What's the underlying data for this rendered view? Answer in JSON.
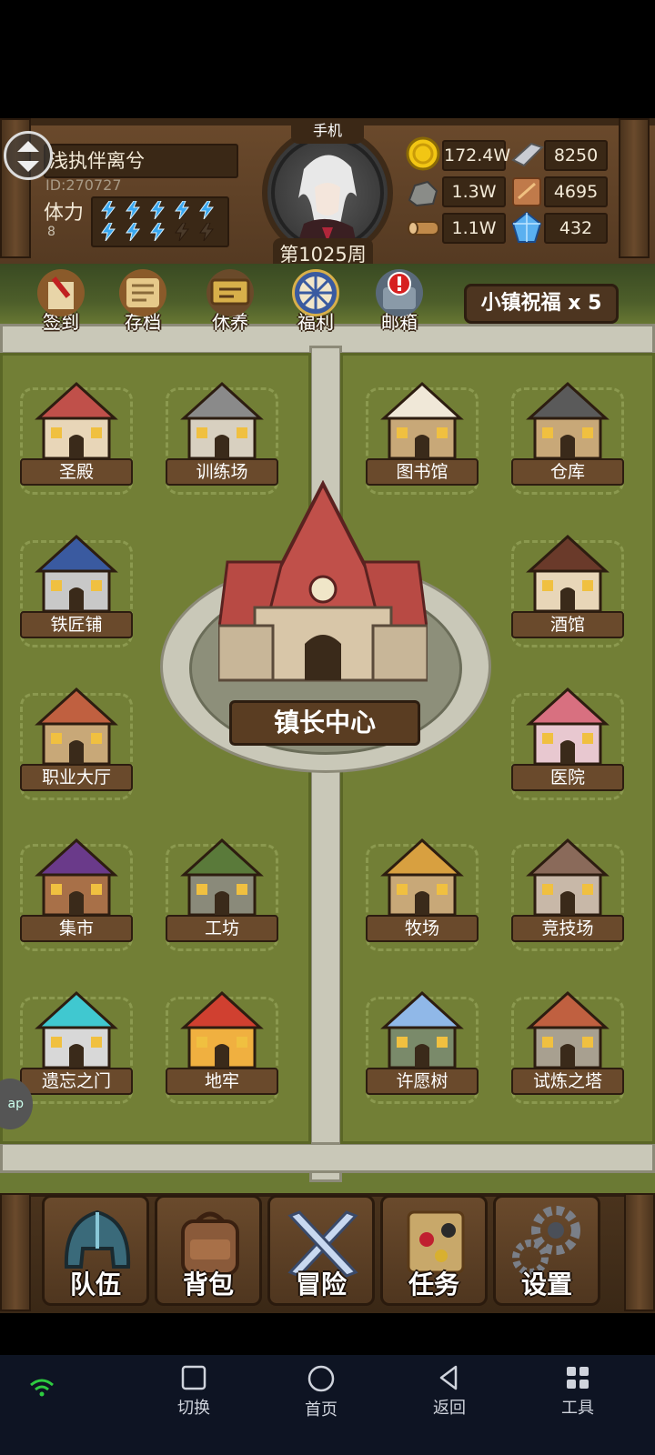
{
  "player": {
    "name": "浅执伴离兮",
    "id_text": "ID:270727",
    "stamina_label": "体力",
    "stamina_value": "8",
    "stamina_filled": 8,
    "stamina_total": 10
  },
  "avatar": {
    "device_tag": "手机",
    "week_label": "第1025周"
  },
  "resources": [
    {
      "icon": "gold-coin-icon",
      "value": "172.4W"
    },
    {
      "icon": "iron-ingot-icon",
      "value": "8250"
    },
    {
      "icon": "stone-icon",
      "value": "1.3W"
    },
    {
      "icon": "leather-icon",
      "value": "4695"
    },
    {
      "icon": "wood-log-icon",
      "value": "1.1W"
    },
    {
      "icon": "crystal-icon",
      "value": "432"
    }
  ],
  "quick_menu": [
    {
      "label": "签到",
      "icon": "sign-in-icon"
    },
    {
      "label": "存档",
      "icon": "save-scroll-icon"
    },
    {
      "label": "休养",
      "icon": "rest-sign-icon"
    },
    {
      "label": "福利",
      "icon": "welfare-wheel-icon"
    },
    {
      "label": "邮箱",
      "icon": "mailbox-icon"
    }
  ],
  "blessing": {
    "label": "小镇祝福 x 5"
  },
  "buildings": [
    {
      "label": "圣殿"
    },
    {
      "label": "训练场"
    },
    {
      "label": "图书馆"
    },
    {
      "label": "仓库"
    },
    {
      "label": "铁匠铺"
    },
    {
      "label": "酒馆"
    },
    {
      "label": "职业大厅"
    },
    {
      "label": "医院"
    },
    {
      "label": "集市"
    },
    {
      "label": "工坊"
    },
    {
      "label": "牧场"
    },
    {
      "label": "竞技场"
    },
    {
      "label": "遗忘之门"
    },
    {
      "label": "地牢"
    },
    {
      "label": "许愿树"
    },
    {
      "label": "试炼之塔"
    }
  ],
  "center": {
    "label": "镇长中心"
  },
  "side_badge": "ap",
  "game_menu": [
    {
      "label": "队伍",
      "icon": "helmet-icon"
    },
    {
      "label": "背包",
      "icon": "backpack-icon"
    },
    {
      "label": "冒险",
      "icon": "crossed-swords-icon"
    },
    {
      "label": "任务",
      "icon": "quest-scroll-icon"
    },
    {
      "label": "设置",
      "icon": "gears-icon"
    }
  ],
  "system_nav": [
    {
      "label": "",
      "icon": "wifi-icon"
    },
    {
      "label": "切换",
      "icon": "square-icon"
    },
    {
      "label": "首页",
      "icon": "circle-icon"
    },
    {
      "label": "返回",
      "icon": "back-triangle-icon"
    },
    {
      "label": "工具",
      "icon": "grid-icon"
    }
  ]
}
